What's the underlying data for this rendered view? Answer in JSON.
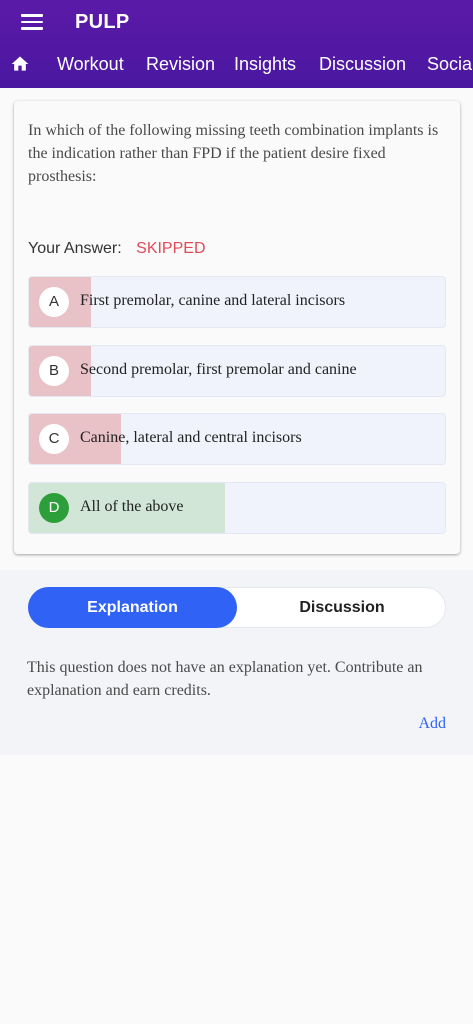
{
  "header": {
    "title": "PULP",
    "tabs": [
      "Workout",
      "Revision",
      "Insights",
      "Discussion",
      "Social"
    ]
  },
  "question": {
    "text": "In which of the following missing teeth combination implants is the indication rather than FPD if the patient desire fixed prosthesis:",
    "your_answer_label": "Your Answer:",
    "your_answer_value": "SKIPPED",
    "options": [
      {
        "letter": "A",
        "text": "First premolar, canine and lateral incisors",
        "percent": 15,
        "correct": false
      },
      {
        "letter": "B",
        "text": "Second premolar, first premolar and canine",
        "percent": 15,
        "correct": false
      },
      {
        "letter": "C",
        "text": "Canine, lateral and central incisors",
        "percent": 22,
        "correct": false
      },
      {
        "letter": "D",
        "text": "All of the above",
        "percent": 47,
        "correct": true
      }
    ]
  },
  "explanation": {
    "tabs": [
      "Explanation",
      "Discussion"
    ],
    "text": "This question does not have an explanation yet. Contribute an explanation and earn credits.",
    "add_label": "Add"
  },
  "colors": {
    "header": "#5214a0",
    "accent": "#3062f5",
    "skipped": "#e04b5a",
    "wrong_fill": "#e9c2c8",
    "correct_fill": "#d1e6d6",
    "correct_badge": "#2c9f3a"
  }
}
